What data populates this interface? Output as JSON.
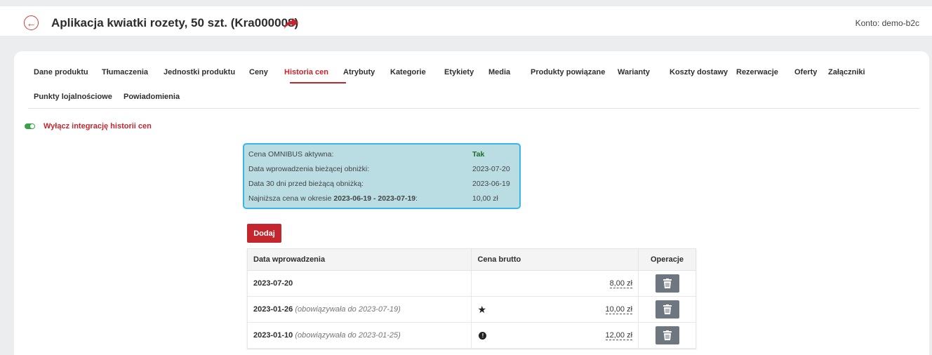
{
  "header": {
    "title": "Aplikacja kwiatki rozety, 50 szt. (Kra000008)",
    "account": "Konto: demo-b2c",
    "accent": "#c4262e"
  },
  "tabs": [
    "Dane produktu",
    "Tłumaczenia",
    "Jednostki produktu",
    "Ceny",
    "Historia cen",
    "Atrybuty",
    "Kategorie",
    "Etykiety",
    "Media",
    "Produkty powiązane",
    "Warianty",
    "Koszty dostawy",
    "Rezerwacje",
    "Oferty",
    "Załączniki",
    "Punkty lojalnościowe",
    "Powiadomienia"
  ],
  "active_tab": "Historia cen",
  "toggle": {
    "label": "Wyłącz integrację historii cen",
    "on": true
  },
  "omnibus": {
    "rows": [
      {
        "label": "Cena OMNIBUS aktywna:",
        "value": "Tak"
      },
      {
        "label": "Data wprowadzenia bieżącej obniżki:",
        "value": "2023-07-20"
      },
      {
        "label": "Data 30 dni przed bieżącą obniżką:",
        "value": "2023-06-19"
      },
      {
        "label_prefix": "Najniższa cena w okresie ",
        "label_bold": "2023-06-19 - 2023-07-19",
        "label_suffix": ":",
        "value": "10,00 zł"
      }
    ]
  },
  "add_button": "Dodaj",
  "table": {
    "headers": [
      "Data wprowadzenia",
      "Cena brutto",
      "Operacje"
    ],
    "rows": [
      {
        "date": "2023-07-20",
        "valid": "",
        "marker": "",
        "price": "8,00 zł"
      },
      {
        "date": "2023-01-26",
        "valid": "(obowiązywała do 2023-07-19)",
        "marker": "star-icon",
        "price": "10,00 zł"
      },
      {
        "date": "2023-01-10",
        "valid": "(obowiązywała do 2023-01-25)",
        "marker": "exclamation-icon",
        "price": "12,00 zł"
      }
    ]
  }
}
